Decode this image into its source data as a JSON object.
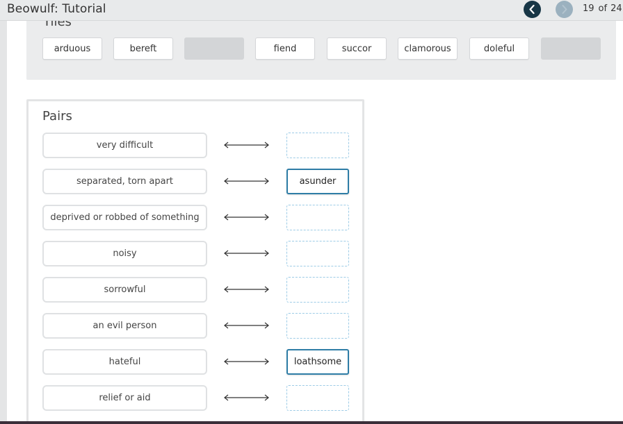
{
  "header": {
    "title": "Beowulf: Tutorial",
    "page_current": "19",
    "page_sep": "of",
    "page_total": "24",
    "prev_icon": "chevron-left-icon",
    "next_icon": "chevron-right-icon"
  },
  "tiles": {
    "heading": "Tiles",
    "items": [
      {
        "label": "arduous",
        "empty": false
      },
      {
        "label": "bereft",
        "empty": false
      },
      {
        "label": "",
        "empty": true
      },
      {
        "label": "fiend",
        "empty": false
      },
      {
        "label": "succor",
        "empty": false
      },
      {
        "label": "clamorous",
        "empty": false
      },
      {
        "label": "doleful",
        "empty": false
      },
      {
        "label": "",
        "empty": true
      }
    ]
  },
  "pairs": {
    "heading": "Pairs",
    "rows": [
      {
        "definition": "very difficult",
        "answer": ""
      },
      {
        "definition": "separated, torn apart",
        "answer": "asunder"
      },
      {
        "definition": "deprived or robbed of something",
        "answer": ""
      },
      {
        "definition": "noisy",
        "answer": ""
      },
      {
        "definition": "sorrowful",
        "answer": ""
      },
      {
        "definition": "an evil person",
        "answer": ""
      },
      {
        "definition": "hateful",
        "answer": "loathsome"
      },
      {
        "definition": "relief or aid",
        "answer": ""
      }
    ]
  },
  "colors": {
    "accent": "#2e7da6",
    "nav_active": "#173646",
    "nav_disabled": "#9bb1bf",
    "dashed_target": "#9ccbe6"
  }
}
